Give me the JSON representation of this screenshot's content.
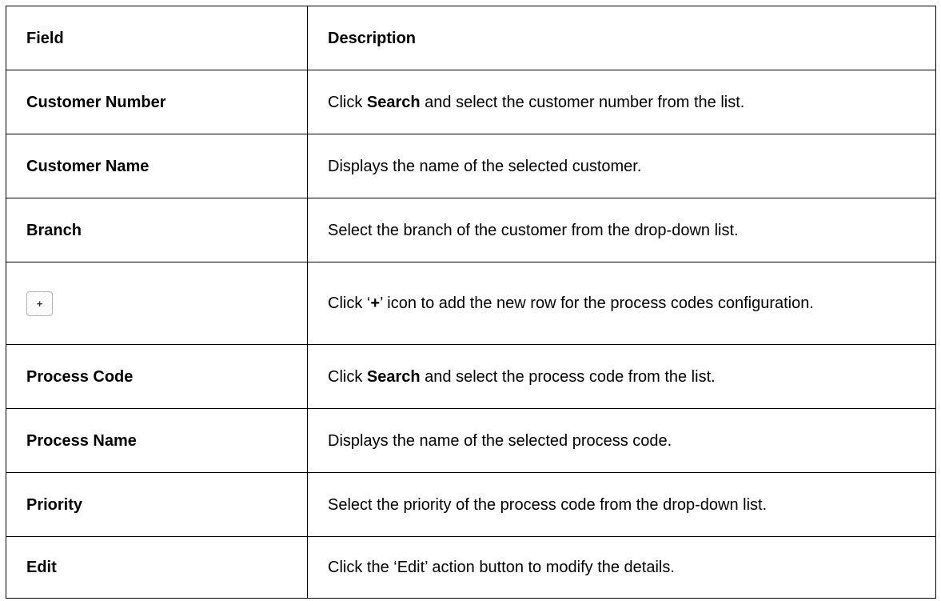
{
  "table": {
    "headers": {
      "field": "Field",
      "description": "Description"
    },
    "rows": [
      {
        "field": "Customer Number",
        "desc_pre": "Click ",
        "desc_bold": "Search",
        "desc_post": " and select the customer number from the list."
      },
      {
        "field": "Customer Name",
        "desc": "Displays the name of the selected customer."
      },
      {
        "field": "Branch",
        "desc": "Select the branch of the customer from the drop-down list."
      },
      {
        "field_icon": "plus-icon",
        "field_symbol": "+",
        "desc_pre": "Click ‘",
        "desc_bold": "+",
        "desc_post": "’ icon to add the new row for the process codes configuration."
      },
      {
        "field": "Process Code",
        "desc_pre": "Click ",
        "desc_bold": "Search",
        "desc_post": " and select the process code from the list."
      },
      {
        "field": "Process Name",
        "desc": "Displays the name of the selected process code."
      },
      {
        "field": "Priority",
        "desc": "Select the priority of the process code from the drop-down list."
      },
      {
        "field": "Edit",
        "desc": "Click the ‘Edit’ action button to modify the details."
      }
    ]
  }
}
